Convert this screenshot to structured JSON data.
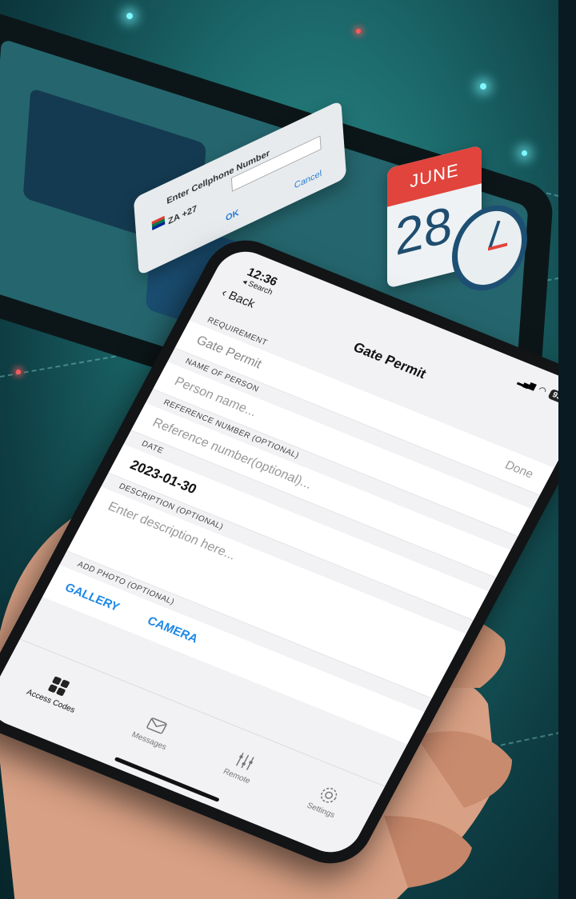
{
  "background": {
    "dialog": {
      "title": "Enter Cellphone Number",
      "code": "ZA +27",
      "ok": "OK",
      "cancel": "Cancel"
    },
    "calendar": {
      "month": "JUNE",
      "day": "28"
    }
  },
  "phone": {
    "status": {
      "time": "12:36",
      "back_app": "◂ Search",
      "battery": "93"
    },
    "nav": {
      "back_label": "Back",
      "title": "Gate Permit"
    },
    "form": {
      "requirement_label": "REQUIREMENT",
      "requirement_value": "Gate Permit",
      "done_label": "Done",
      "name_label": "NAME OF PERSON",
      "name_placeholder": "Person name...",
      "reference_label": "REFERENCE NUMBER (OPTIONAL)",
      "reference_placeholder": "Reference number(optional)...",
      "date_label": "DATE",
      "date_value": "2023-01-30",
      "description_label": "DESCRIPTION (OPTIONAL)",
      "description_placeholder": "Enter description here...",
      "photo_label": "ADD PHOTO (OPTIONAL)",
      "gallery_label": "GALLERY",
      "camera_label": "CAMERA"
    },
    "tabs": [
      {
        "label": "Access Codes",
        "icon": "grid-icon"
      },
      {
        "label": "Messages",
        "icon": "envelope-icon"
      },
      {
        "label": "Remote",
        "icon": "sliders-icon"
      },
      {
        "label": "Settings",
        "icon": "gear-icon"
      }
    ]
  },
  "colors": {
    "accent": "#1e88e5",
    "calendar_red": "#e0443c",
    "teal_bg": "#1c6a6c"
  }
}
